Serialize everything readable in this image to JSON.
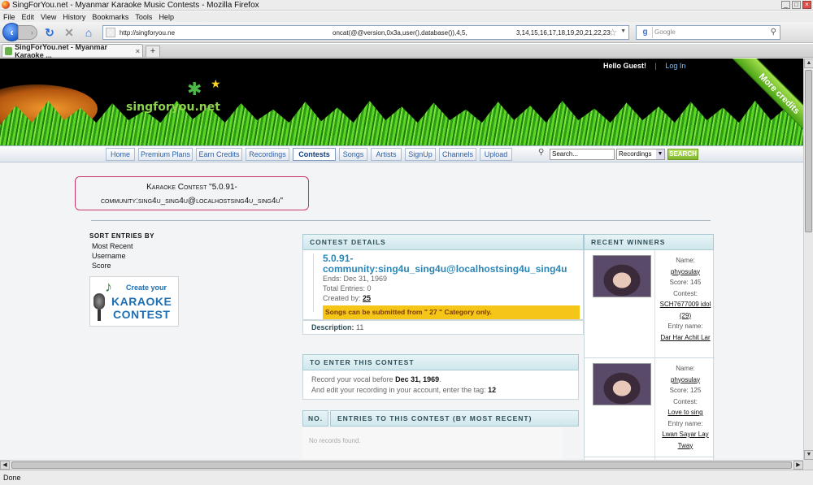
{
  "window": {
    "title": "SingForYou.net - Myanmar Karaoke Music Contests - Mozilla Firefox"
  },
  "menu": [
    "File",
    "Edit",
    "View",
    "History",
    "Bookmarks",
    "Tools",
    "Help"
  ],
  "address": {
    "url_start": "http://singforyou.ne",
    "url_mid": "oncat(@@version,0x3a,user(),database()),4,5,",
    "url_end": "3,14,15,16,17,18,19,20,21,22,23"
  },
  "search_engine": {
    "placeholder": "Google"
  },
  "tab": {
    "label": "SingForYou.net - Myanmar Karaoke ...",
    "new": "+"
  },
  "header": {
    "greeting": "Hello Guest!",
    "separator": "|",
    "login": "Log In",
    "logo": "singforyou.net",
    "ribbon": "More credits"
  },
  "nav": [
    {
      "label": "Home",
      "active": false
    },
    {
      "label": "Premium Plans",
      "active": false
    },
    {
      "label": "Earn Credits",
      "active": false
    },
    {
      "label": "Recordings",
      "active": false
    },
    {
      "label": "Contests",
      "active": true
    },
    {
      "label": "Songs",
      "active": false
    },
    {
      "label": "Artists",
      "active": false
    },
    {
      "label": "SignUp",
      "active": false
    },
    {
      "label": "Channels",
      "active": false
    },
    {
      "label": "Upload",
      "active": false
    }
  ],
  "site_search": {
    "value": "Search...",
    "category": "Recordings",
    "button": "SEARCH"
  },
  "contest_title": {
    "line1": "Karaoke Contest  \"5.0.91-",
    "line2": "community:sing4u_sing4u@localhostsing4u_sing4u\""
  },
  "sort": {
    "heading": "SORT ENTRIES BY",
    "options": [
      "Most Recent",
      "Username",
      "Score"
    ]
  },
  "banner": {
    "line1": "Create your",
    "line2": "KARAOKE",
    "line3": "CONTEST"
  },
  "details": {
    "heading": "CONTEST DETAILS",
    "title_l1": "5.0.91-",
    "title_l2": "community:sing4u_sing4u@localhostsing4u_sing4u",
    "ends": "Ends: Dec 31, 1969",
    "total": "Total Entries: 0",
    "created_label": "Created by:",
    "created_by": "25",
    "warning": "Songs can be submitted from \" 27 \" Category only.",
    "desc_label": "Description:",
    "desc_value": "11"
  },
  "enter": {
    "heading": "TO ENTER THIS CONTEST",
    "l1a": "Record your vocal before",
    "l1b": "Dec 31, 1969",
    "l1c": ".",
    "l2a": "And edit your recording in your account, enter the tag:",
    "l2b": "12"
  },
  "entries": {
    "col_no": "NO.",
    "heading": "ENTRIES TO THIS CONTEST (BY MOST RECENT)",
    "empty": "No records found."
  },
  "winners": {
    "heading": "RECENT WINNERS",
    "items": [
      {
        "name_label": "Name:",
        "name": "phyosulay",
        "score": "Score: 145",
        "contest_label": "Contest:",
        "contest": "SCH7677009 idol (29)",
        "entry_label": "Entry name:",
        "entry": "Dar Har Achit Lar"
      },
      {
        "name_label": "Name:",
        "name": "phyosulay",
        "score": "Score: 125",
        "contest_label": "Contest:",
        "contest": "Love to sing",
        "entry_label": "Entry name:",
        "entry": "Lwan Sayar Lay Tway"
      }
    ]
  },
  "statusbar": {
    "text": "Done"
  }
}
